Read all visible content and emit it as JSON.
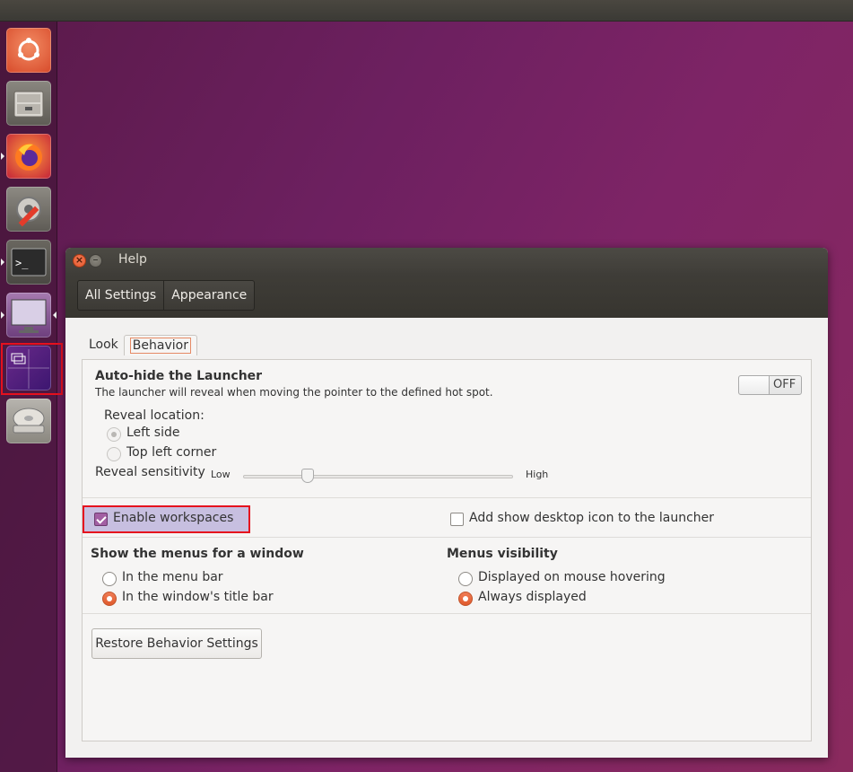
{
  "launcher": {
    "items": [
      {
        "name": "ubuntu-dash-icon"
      },
      {
        "name": "files-icon"
      },
      {
        "name": "firefox-icon"
      },
      {
        "name": "system-settings-icon"
      },
      {
        "name": "terminal-icon"
      },
      {
        "name": "display-settings-icon"
      },
      {
        "name": "workspace-switcher-icon"
      },
      {
        "name": "disk-drive-icon"
      }
    ]
  },
  "window": {
    "title": "Help",
    "breadcrumbs": [
      "All Settings",
      "Appearance"
    ]
  },
  "tabs": [
    {
      "label": "Look",
      "active": false
    },
    {
      "label": "Behavior",
      "active": true
    }
  ],
  "autohide": {
    "title": "Auto-hide the Launcher",
    "description": "The launcher will reveal when moving the pointer to the defined hot spot.",
    "switch_label": "OFF",
    "reveal_location_label": "Reveal location:",
    "options": [
      "Left side",
      "Top left corner"
    ],
    "selected": "Left side",
    "sensitivity_label": "Reveal sensitivity",
    "sensitivity_low": "Low",
    "sensitivity_high": "High",
    "sensitivity_value": 0.24
  },
  "workspaces": {
    "enable_label": "Enable workspaces",
    "enable_checked": true,
    "desktop_icon_label": "Add show desktop icon to the launcher",
    "desktop_icon_checked": false
  },
  "menus": {
    "title": "Show the menus for a window",
    "options": [
      "In the menu bar",
      "In the window's title bar"
    ],
    "selected": "In the window's title bar"
  },
  "visibility": {
    "title": "Menus visibility",
    "options": [
      "Displayed on mouse hovering",
      "Always displayed"
    ],
    "selected": "Always displayed"
  },
  "restore_button": "Restore Behavior Settings",
  "colors": {
    "accent": "#e05a2c",
    "checkbox": "#a25fa3",
    "highlight": "#e5101e"
  }
}
